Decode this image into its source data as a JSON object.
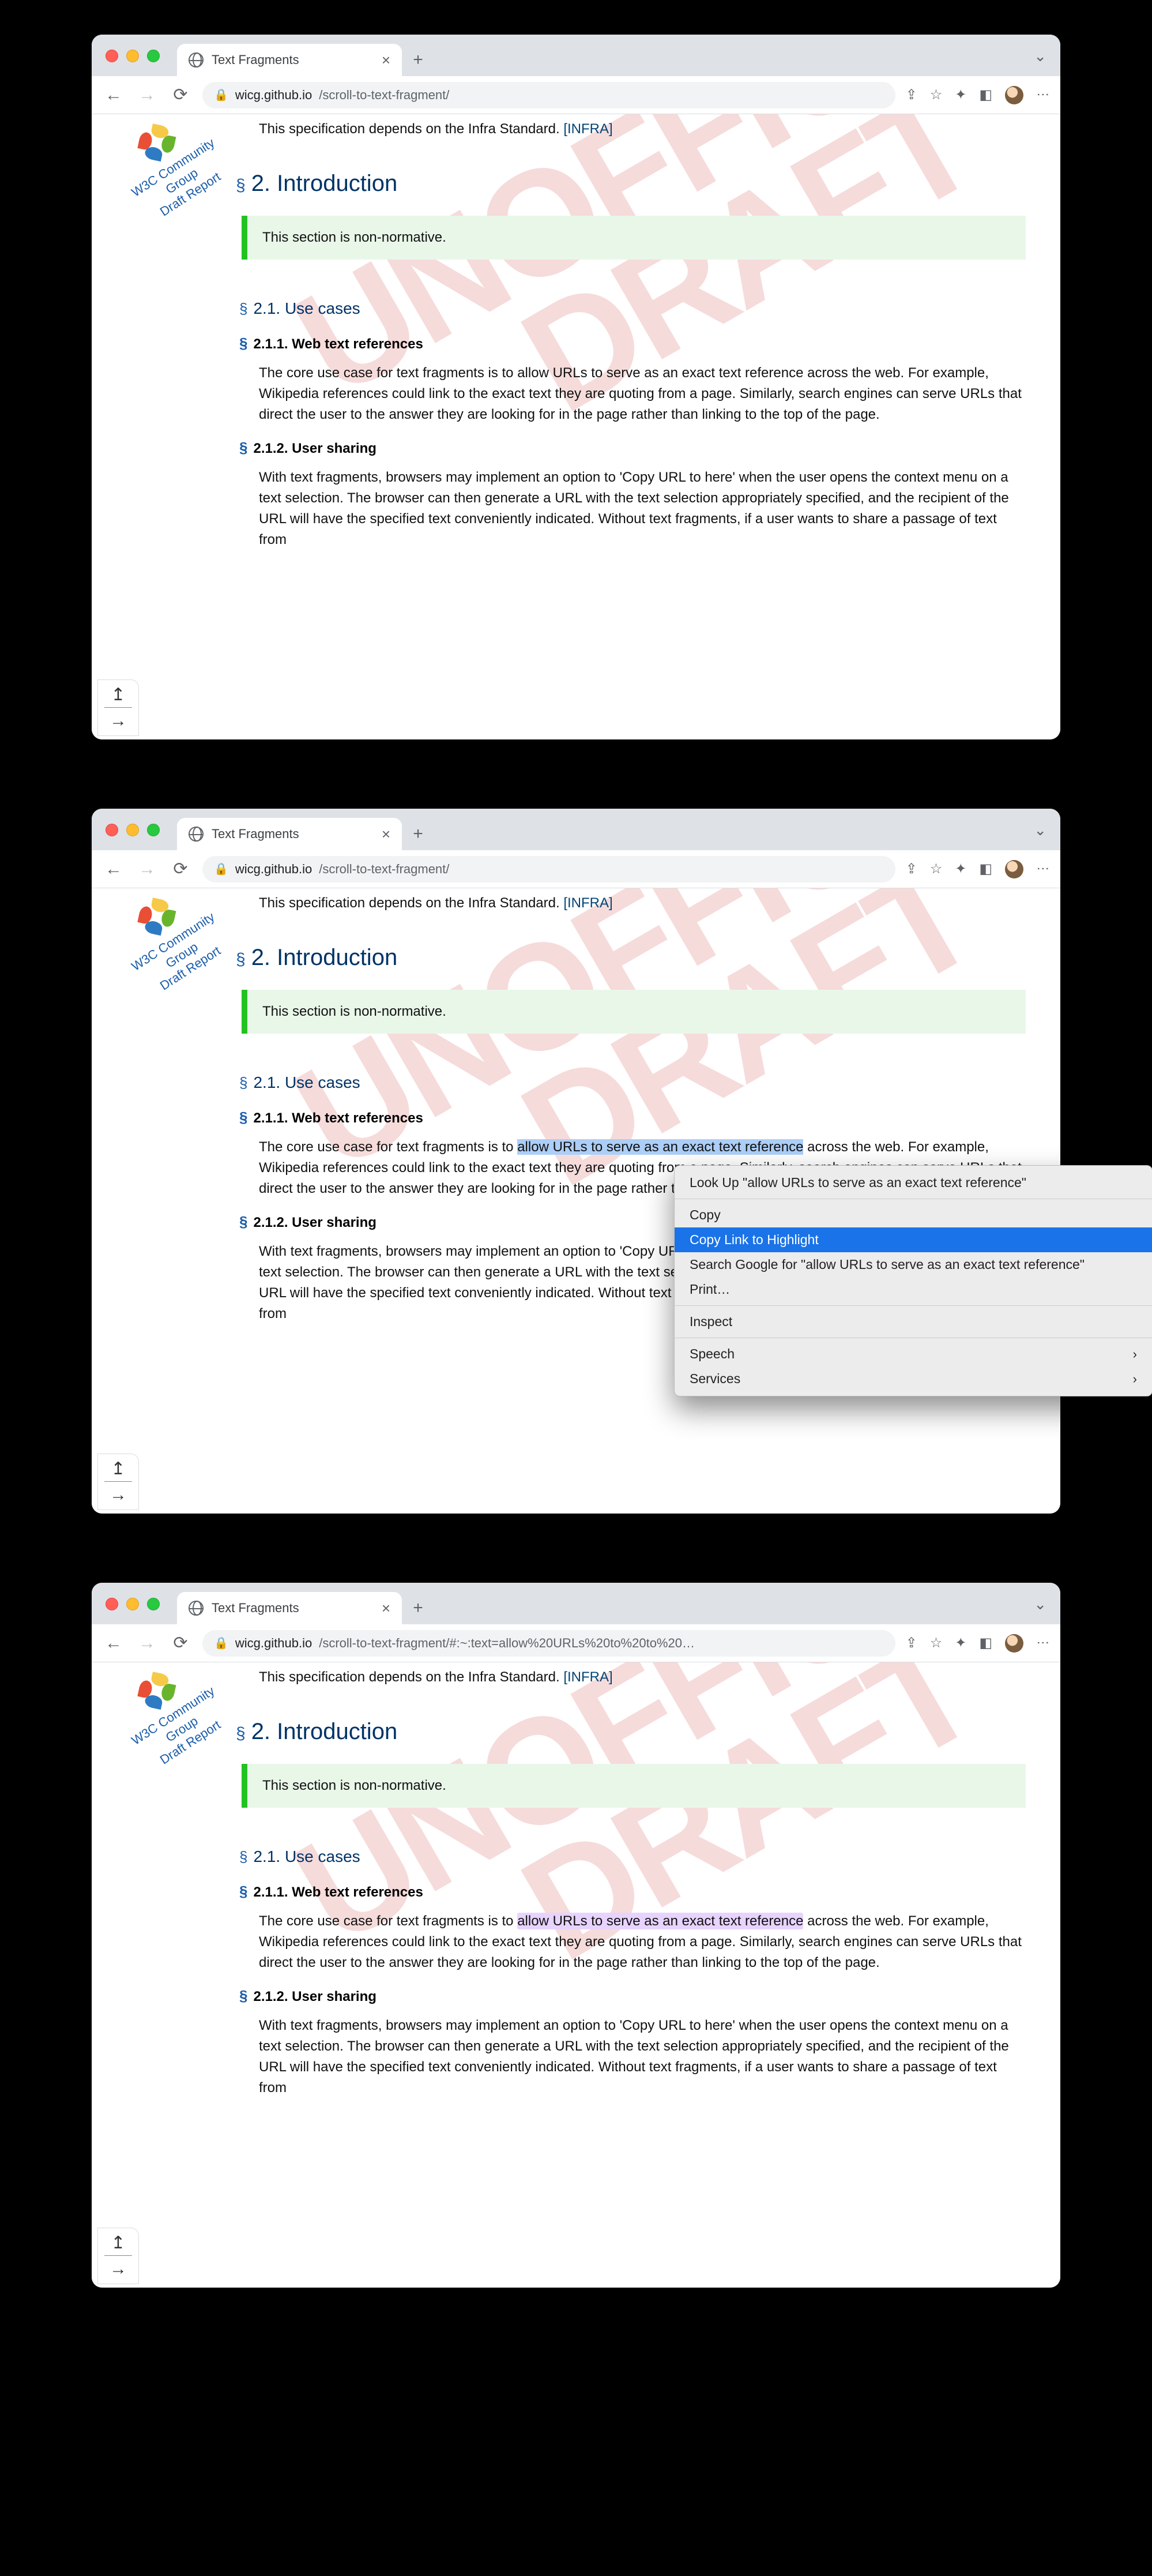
{
  "common": {
    "tab_title": "Text Fragments",
    "url_domain": "wicg.github.io",
    "url_path_short": "/scroll-to-text-fragment/",
    "url_path_frag": "/scroll-to-text-fragment/#:~:text=allow%20URLs%20to%20to%20…",
    "watermark_line1": "UNOFFICIAL",
    "watermark_line2": "DRAFT",
    "logo_line1": "W3C Community Group",
    "logo_line2": "Draft Report",
    "depends_text_pre": "This specification depends on the Infra Standard. ",
    "depends_link": "[INFRA]",
    "h2_intro": "2. Introduction",
    "note_text": "This section is non-normative.",
    "h3_usecases": "2.1. Use cases",
    "h4_webref": "2.1.1. Web text references",
    "para_webref_pre": "The core use case for text fragments is to ",
    "para_webref_hl": "allow URLs to serve as an exact text reference",
    "para_webref_post": " across the web. For example, Wikipedia references could link to the exact text they are quoting from a page. Similarly, search engines can serve URLs that direct the user to the answer they are looking for in the page rather than linking to the top of the page.",
    "h4_usershare": "2.1.2. User sharing",
    "para_share": "With text fragments, browsers may implement an option to 'Copy URL to here' when the user opens the context menu on a text selection. The browser can then generate a URL with the text selection appropriately specified, and the recipient of the URL will have the specified text conveniently indicated. Without text fragments, if a user wants to share a passage of text from"
  },
  "ctx": {
    "lookup": "Look Up \"allow URLs to serve as an exact text reference\"",
    "copy": "Copy",
    "copylink": "Copy Link to Highlight",
    "search": "Search Google for \"allow URLs to serve as an exact text reference\"",
    "print": "Print…",
    "inspect": "Inspect",
    "speech": "Speech",
    "services": "Services"
  }
}
